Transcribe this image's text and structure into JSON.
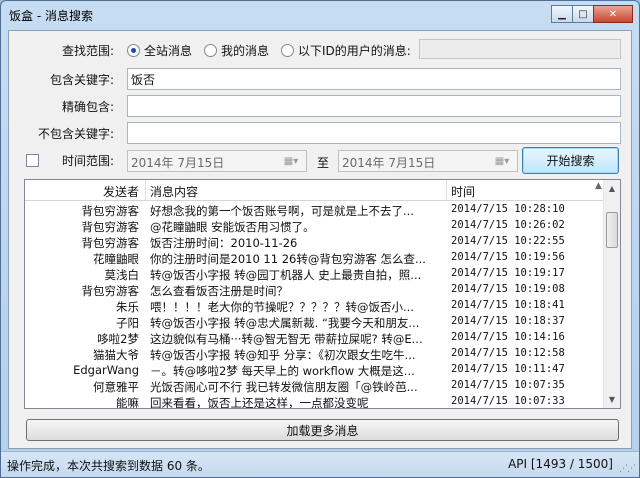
{
  "window": {
    "title": "饭盒 - 消息搜索",
    "minimize_glyph": "▁",
    "maximize_glyph": "□",
    "close_glyph": "✕"
  },
  "search_scope": {
    "label": "查找范围:",
    "options": [
      "全站消息",
      "我的消息",
      "以下ID的用户的消息:"
    ],
    "selected_index": 0,
    "user_id_value": ""
  },
  "include_keywords": {
    "label": "包含关键字:",
    "value": "饭否"
  },
  "exact_include": {
    "label": "精确包含:",
    "value": ""
  },
  "exclude_keywords": {
    "label": "不包含关键字:",
    "value": ""
  },
  "time_range": {
    "label": "时间范围:",
    "enabled": false,
    "from": "2014年  7月15日",
    "to_label": "至",
    "to": "2014年  7月15日"
  },
  "search_button": "开始搜索",
  "results": {
    "columns": [
      "发送者",
      "消息内容",
      "时间"
    ],
    "sort_indicator": "▲",
    "rows": [
      {
        "sender": "背包穷游客",
        "content": "好想念我的第一个饭否账号啊，可是就是上不去了...",
        "time": "2014/7/15 10:28:10"
      },
      {
        "sender": "背包穷游客",
        "content": "@花瞳鼬眼 安能饭否用习惯了。",
        "time": "2014/7/15 10:26:02"
      },
      {
        "sender": "背包穷游客",
        "content": "饭否注册时间：2010-11-26",
        "time": "2014/7/15 10:22:55"
      },
      {
        "sender": "花瞳鼬眼",
        "content": "你的注册时间是2010 11 26转@背包穷游客 怎么查...",
        "time": "2014/7/15 10:19:56"
      },
      {
        "sender": "莫浅白",
        "content": "转@饭否小字报 转@园丁机器人 史上最贵自拍，照...",
        "time": "2014/7/15 10:19:17"
      },
      {
        "sender": "背包穷游客",
        "content": "怎么查看饭否注册是时间？",
        "time": "2014/7/15 10:19:08"
      },
      {
        "sender": "朱乐",
        "content": "喂！！！！老大你的节操呢？？？？？转@饭否小...",
        "time": "2014/7/15 10:18:41"
      },
      {
        "sender": "子阳",
        "content": "转@饭否小字报 转@忠犬属新裁. “我要今天和朋友...",
        "time": "2014/7/15 10:18:37"
      },
      {
        "sender": "哆啦2梦",
        "content": "这边貌似有马桶···转@智无智无 带薪拉屎呢? 转@E...",
        "time": "2014/7/15 10:14:16"
      },
      {
        "sender": "猫猫大爷",
        "content": "转@饭否小字报 转@知乎 分享：《初次跟女生吃牛...",
        "time": "2014/7/15 10:12:58"
      },
      {
        "sender": "EdgarWang",
        "content": "－。转@哆啦2梦 每天早上的 workflow 大概是这...",
        "time": "2014/7/15 10:11:47"
      },
      {
        "sender": "何意雅平",
        "content": "光饭否闹心可不行 我已转发微信朋友圈「@铁岭芭...",
        "time": "2014/7/15 10:07:35"
      },
      {
        "sender": "能嘛",
        "content": "回来看看，饭否上还是这样，一点都没变呢",
        "time": "2014/7/15 10:07:33"
      }
    ]
  },
  "load_more_button": "加载更多消息",
  "status": {
    "left": "操作完成，本次共搜索到数据 60 条。",
    "right": "API [1493 / 1500]"
  }
}
